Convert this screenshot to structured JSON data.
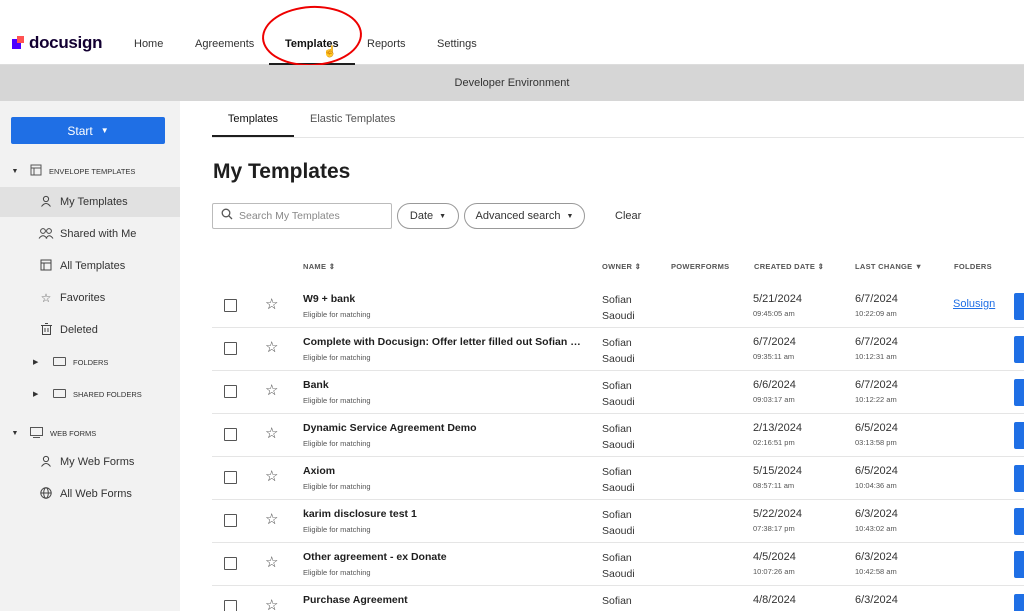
{
  "brand": {
    "name": "docusign"
  },
  "nav": {
    "home": "Home",
    "agreements": "Agreements",
    "templates": "Templates",
    "reports": "Reports",
    "settings": "Settings"
  },
  "banner": "Developer Environment",
  "sidebar": {
    "start_label": "Start",
    "envelope_templates": "ENVELOPE TEMPLATES",
    "items": [
      {
        "label": "My Templates",
        "icon": "person-icon"
      },
      {
        "label": "Shared with Me",
        "icon": "people-icon"
      },
      {
        "label": "All Templates",
        "icon": "template-icon"
      },
      {
        "label": "Favorites",
        "icon": "star-icon"
      },
      {
        "label": "Deleted",
        "icon": "trash-icon"
      }
    ],
    "folders": "FOLDERS",
    "shared_folders": "SHARED FOLDERS",
    "web_forms": "WEB FORMS",
    "web_items": [
      {
        "label": "My Web Forms",
        "icon": "person-icon"
      },
      {
        "label": "All Web Forms",
        "icon": "globe-icon"
      }
    ]
  },
  "tabs": {
    "templates": "Templates",
    "elastic": "Elastic Templates"
  },
  "page_title": "My Templates",
  "search": {
    "placeholder": "Search My Templates"
  },
  "filters": {
    "date": "Date",
    "advanced": "Advanced search",
    "clear": "Clear"
  },
  "columns": {
    "name": "NAME",
    "owner": "OWNER",
    "powerforms": "POWERFORMS",
    "created": "CREATED DATE",
    "last_change": "LAST CHANGE",
    "folders": "FOLDERS"
  },
  "rows": [
    {
      "name": "W9 + bank",
      "sub": "Eligible for matching",
      "owner_first": "Sofian",
      "owner_last": "Saoudi",
      "created_date": "5/21/2024",
      "created_time": "09:45:05 am",
      "last_date": "6/7/2024",
      "last_time": "10:22:09 am",
      "folder": "Solusign"
    },
    {
      "name": "Complete with Docusign: Offer letter filled out Sofian ex...",
      "sub": "Eligible for matching",
      "owner_first": "Sofian",
      "owner_last": "Saoudi",
      "created_date": "6/7/2024",
      "created_time": "09:35:11 am",
      "last_date": "6/7/2024",
      "last_time": "10:12:31 am",
      "folder": ""
    },
    {
      "name": "Bank",
      "sub": "Eligible for matching",
      "owner_first": "Sofian",
      "owner_last": "Saoudi",
      "created_date": "6/6/2024",
      "created_time": "09:03:17 am",
      "last_date": "6/7/2024",
      "last_time": "10:12:22 am",
      "folder": ""
    },
    {
      "name": "Dynamic Service Agreement Demo",
      "sub": "Eligible for matching",
      "owner_first": "Sofian",
      "owner_last": "Saoudi",
      "created_date": "2/13/2024",
      "created_time": "02:16:51 pm",
      "last_date": "6/5/2024",
      "last_time": "03:13:58 pm",
      "folder": ""
    },
    {
      "name": "Axiom",
      "sub": "Eligible for matching",
      "owner_first": "Sofian",
      "owner_last": "Saoudi",
      "created_date": "5/15/2024",
      "created_time": "08:57:11 am",
      "last_date": "6/5/2024",
      "last_time": "10:04:36 am",
      "folder": ""
    },
    {
      "name": "karim disclosure test 1",
      "sub": "Eligible for matching",
      "owner_first": "Sofian",
      "owner_last": "Saoudi",
      "created_date": "5/22/2024",
      "created_time": "07:38:17 pm",
      "last_date": "6/3/2024",
      "last_time": "10:43:02 am",
      "folder": ""
    },
    {
      "name": "Other agreement - ex Donate",
      "sub": "Eligible for matching",
      "owner_first": "Sofian",
      "owner_last": "Saoudi",
      "created_date": "4/5/2024",
      "created_time": "10:07:26 am",
      "last_date": "6/3/2024",
      "last_time": "10:42:58 am",
      "folder": ""
    },
    {
      "name": "Purchase Agreement",
      "sub": "",
      "owner_first": "Sofian",
      "owner_last": "",
      "created_date": "4/8/2024",
      "created_time": "",
      "last_date": "6/3/2024",
      "last_time": "",
      "folder": ""
    }
  ]
}
